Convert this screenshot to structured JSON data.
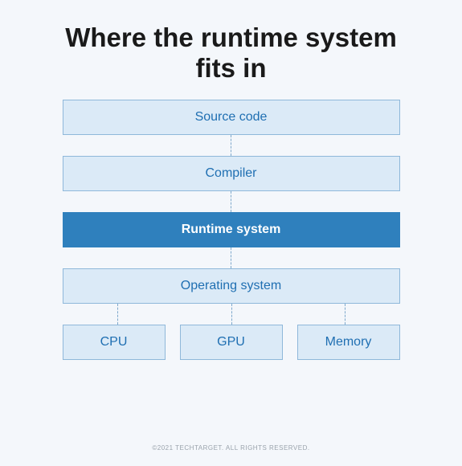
{
  "title": "Where the runtime system fits in",
  "layers": {
    "source": "Source code",
    "compiler": "Compiler",
    "runtime": "Runtime system",
    "os": "Operating system"
  },
  "hardware": {
    "cpu": "CPU",
    "gpu": "GPU",
    "memory": "Memory"
  },
  "footer": "©2021 TechTarget. All rights reserved.",
  "colors": {
    "light_box_bg": "#dbeaf7",
    "light_box_border": "#8fb8da",
    "light_box_text": "#1f6fb2",
    "dark_box_bg": "#2f80bd",
    "dark_box_text": "#ffffff",
    "page_bg": "#f4f7fb"
  }
}
